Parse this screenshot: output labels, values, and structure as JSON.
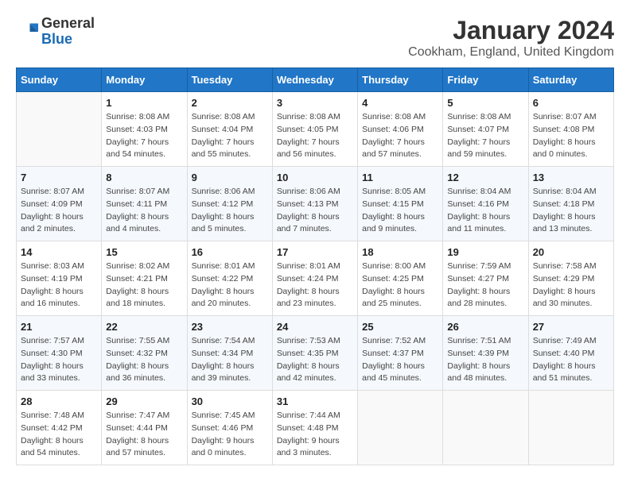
{
  "header": {
    "logo_general": "General",
    "logo_blue": "Blue",
    "title": "January 2024",
    "subtitle": "Cookham, England, United Kingdom"
  },
  "weekdays": [
    "Sunday",
    "Monday",
    "Tuesday",
    "Wednesday",
    "Thursday",
    "Friday",
    "Saturday"
  ],
  "weeks": [
    [
      {
        "day": "",
        "empty": true
      },
      {
        "day": "1",
        "sunrise": "Sunrise: 8:08 AM",
        "sunset": "Sunset: 4:03 PM",
        "daylight": "Daylight: 7 hours and 54 minutes."
      },
      {
        "day": "2",
        "sunrise": "Sunrise: 8:08 AM",
        "sunset": "Sunset: 4:04 PM",
        "daylight": "Daylight: 7 hours and 55 minutes."
      },
      {
        "day": "3",
        "sunrise": "Sunrise: 8:08 AM",
        "sunset": "Sunset: 4:05 PM",
        "daylight": "Daylight: 7 hours and 56 minutes."
      },
      {
        "day": "4",
        "sunrise": "Sunrise: 8:08 AM",
        "sunset": "Sunset: 4:06 PM",
        "daylight": "Daylight: 7 hours and 57 minutes."
      },
      {
        "day": "5",
        "sunrise": "Sunrise: 8:08 AM",
        "sunset": "Sunset: 4:07 PM",
        "daylight": "Daylight: 7 hours and 59 minutes."
      },
      {
        "day": "6",
        "sunrise": "Sunrise: 8:07 AM",
        "sunset": "Sunset: 4:08 PM",
        "daylight": "Daylight: 8 hours and 0 minutes."
      }
    ],
    [
      {
        "day": "7",
        "sunrise": "Sunrise: 8:07 AM",
        "sunset": "Sunset: 4:09 PM",
        "daylight": "Daylight: 8 hours and 2 minutes."
      },
      {
        "day": "8",
        "sunrise": "Sunrise: 8:07 AM",
        "sunset": "Sunset: 4:11 PM",
        "daylight": "Daylight: 8 hours and 4 minutes."
      },
      {
        "day": "9",
        "sunrise": "Sunrise: 8:06 AM",
        "sunset": "Sunset: 4:12 PM",
        "daylight": "Daylight: 8 hours and 5 minutes."
      },
      {
        "day": "10",
        "sunrise": "Sunrise: 8:06 AM",
        "sunset": "Sunset: 4:13 PM",
        "daylight": "Daylight: 8 hours and 7 minutes."
      },
      {
        "day": "11",
        "sunrise": "Sunrise: 8:05 AM",
        "sunset": "Sunset: 4:15 PM",
        "daylight": "Daylight: 8 hours and 9 minutes."
      },
      {
        "day": "12",
        "sunrise": "Sunrise: 8:04 AM",
        "sunset": "Sunset: 4:16 PM",
        "daylight": "Daylight: 8 hours and 11 minutes."
      },
      {
        "day": "13",
        "sunrise": "Sunrise: 8:04 AM",
        "sunset": "Sunset: 4:18 PM",
        "daylight": "Daylight: 8 hours and 13 minutes."
      }
    ],
    [
      {
        "day": "14",
        "sunrise": "Sunrise: 8:03 AM",
        "sunset": "Sunset: 4:19 PM",
        "daylight": "Daylight: 8 hours and 16 minutes."
      },
      {
        "day": "15",
        "sunrise": "Sunrise: 8:02 AM",
        "sunset": "Sunset: 4:21 PM",
        "daylight": "Daylight: 8 hours and 18 minutes."
      },
      {
        "day": "16",
        "sunrise": "Sunrise: 8:01 AM",
        "sunset": "Sunset: 4:22 PM",
        "daylight": "Daylight: 8 hours and 20 minutes."
      },
      {
        "day": "17",
        "sunrise": "Sunrise: 8:01 AM",
        "sunset": "Sunset: 4:24 PM",
        "daylight": "Daylight: 8 hours and 23 minutes."
      },
      {
        "day": "18",
        "sunrise": "Sunrise: 8:00 AM",
        "sunset": "Sunset: 4:25 PM",
        "daylight": "Daylight: 8 hours and 25 minutes."
      },
      {
        "day": "19",
        "sunrise": "Sunrise: 7:59 AM",
        "sunset": "Sunset: 4:27 PM",
        "daylight": "Daylight: 8 hours and 28 minutes."
      },
      {
        "day": "20",
        "sunrise": "Sunrise: 7:58 AM",
        "sunset": "Sunset: 4:29 PM",
        "daylight": "Daylight: 8 hours and 30 minutes."
      }
    ],
    [
      {
        "day": "21",
        "sunrise": "Sunrise: 7:57 AM",
        "sunset": "Sunset: 4:30 PM",
        "daylight": "Daylight: 8 hours and 33 minutes."
      },
      {
        "day": "22",
        "sunrise": "Sunrise: 7:55 AM",
        "sunset": "Sunset: 4:32 PM",
        "daylight": "Daylight: 8 hours and 36 minutes."
      },
      {
        "day": "23",
        "sunrise": "Sunrise: 7:54 AM",
        "sunset": "Sunset: 4:34 PM",
        "daylight": "Daylight: 8 hours and 39 minutes."
      },
      {
        "day": "24",
        "sunrise": "Sunrise: 7:53 AM",
        "sunset": "Sunset: 4:35 PM",
        "daylight": "Daylight: 8 hours and 42 minutes."
      },
      {
        "day": "25",
        "sunrise": "Sunrise: 7:52 AM",
        "sunset": "Sunset: 4:37 PM",
        "daylight": "Daylight: 8 hours and 45 minutes."
      },
      {
        "day": "26",
        "sunrise": "Sunrise: 7:51 AM",
        "sunset": "Sunset: 4:39 PM",
        "daylight": "Daylight: 8 hours and 48 minutes."
      },
      {
        "day": "27",
        "sunrise": "Sunrise: 7:49 AM",
        "sunset": "Sunset: 4:40 PM",
        "daylight": "Daylight: 8 hours and 51 minutes."
      }
    ],
    [
      {
        "day": "28",
        "sunrise": "Sunrise: 7:48 AM",
        "sunset": "Sunset: 4:42 PM",
        "daylight": "Daylight: 8 hours and 54 minutes."
      },
      {
        "day": "29",
        "sunrise": "Sunrise: 7:47 AM",
        "sunset": "Sunset: 4:44 PM",
        "daylight": "Daylight: 8 hours and 57 minutes."
      },
      {
        "day": "30",
        "sunrise": "Sunrise: 7:45 AM",
        "sunset": "Sunset: 4:46 PM",
        "daylight": "Daylight: 9 hours and 0 minutes."
      },
      {
        "day": "31",
        "sunrise": "Sunrise: 7:44 AM",
        "sunset": "Sunset: 4:48 PM",
        "daylight": "Daylight: 9 hours and 3 minutes."
      },
      {
        "day": "",
        "empty": true
      },
      {
        "day": "",
        "empty": true
      },
      {
        "day": "",
        "empty": true
      }
    ]
  ]
}
